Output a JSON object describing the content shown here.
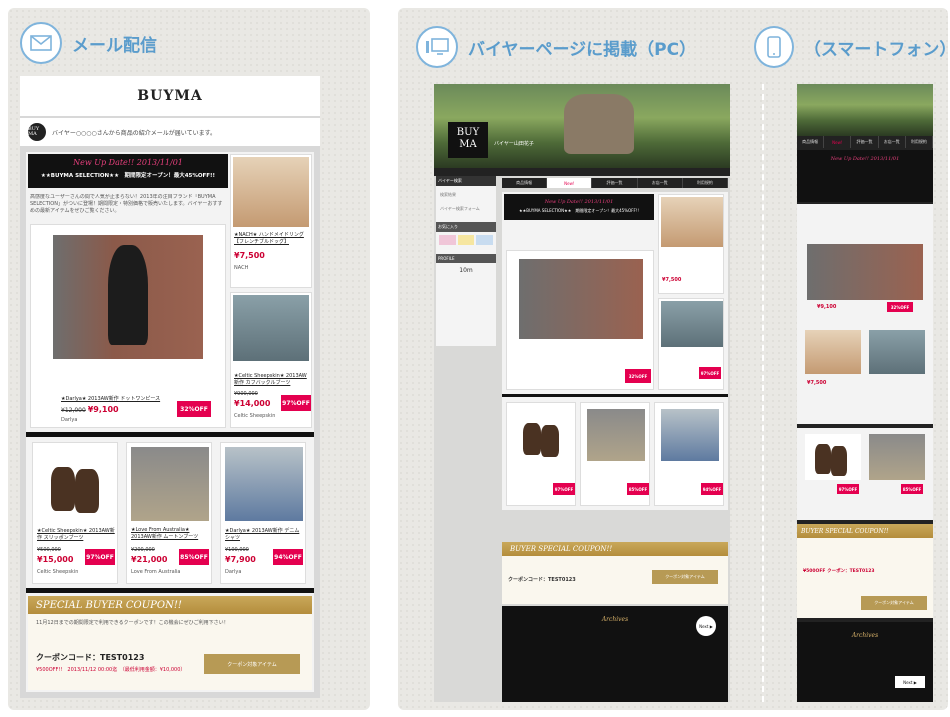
{
  "sections": {
    "mail": {
      "title": "メール配信",
      "icon": "envelope-icon"
    },
    "pc": {
      "title": "バイヤーページに掲載（PC）",
      "icon": "monitor-icon"
    },
    "sp": {
      "title": "（スマートフォン）",
      "icon": "smartphone-icon"
    }
  },
  "email": {
    "brand": "BUYMA",
    "logo_text": "BUY MA",
    "sender_line": "バイヤー○○○○さんから商品の紹介メールが届いています。",
    "banner": {
      "script": "New Up Date!! 2013/11/01",
      "headline": "★★BUYMA SELECTION★★　期間限定オープン！最大45%OFF!!"
    },
    "intro": "高感度なユーザーさんの間で人気が止まらない！2013年の注目ブランド「BUYMA SELECTION」がついに登場！期間限定・特別価格で販売いたします。バイヤーおすすめの最新アイテムをぜひご覧ください。",
    "products": [
      {
        "name": "★Darlya★ 2013AW新作 ドットワンピース",
        "orig": "¥12,000",
        "price": "¥9,100",
        "off": "32%OFF",
        "shop": "Darlya"
      },
      {
        "name": "★NACH★ ハンドメイドリング【フレンチブルドッグ】",
        "price": "¥7,500",
        "shop": "NACH"
      },
      {
        "name": "★Celtic Sheepskin★ 2013AW新作 カフバックルブーツ",
        "orig": "¥900,000",
        "price": "¥14,000",
        "off": "97%OFF",
        "shop": "Celtic Sheepskin"
      },
      {
        "name": "★Celtic Sheepskin★ 2013AW新作 スリッポンブーツ",
        "orig": "¥500,000",
        "price": "¥15,000",
        "off": "97%OFF",
        "shop": "Celtic Sheepskin"
      },
      {
        "name": "★Love From Australia★ 2013AW新作 ムートンブーツ",
        "orig": "¥200,000",
        "price": "¥21,000",
        "off": "85%OFF",
        "shop": "Love From Australia"
      },
      {
        "name": "★Darlya★ 2013AW新作 デニムシャツ",
        "orig": "¥100,000",
        "price": "¥7,900",
        "off": "94%OFF",
        "shop": "Darlya"
      }
    ],
    "coupon": {
      "heading": "SPECIAL BUYER COUPON!!",
      "note": "11月12日までの期間限定で利用できるクーポンです！この機会にぜひご利用下さい！",
      "code_label": "クーポンコード：TEST0123",
      "detail": "¥500OFF!!　2013/11/12 00:00迄　（最低利用金額：¥10,000）",
      "button": "クーポン対象アイテム"
    }
  },
  "pc": {
    "logo": "BUY MA",
    "buyer_name": "バイヤー山田花子",
    "tabs": [
      "商品情報",
      "New!",
      "評価一覧",
      "お店一覧",
      "利用規約"
    ],
    "side": [
      "バイヤー検索",
      "検索結果",
      "バイヤー検索フォーム",
      "お気に入り",
      "PROFILE"
    ],
    "follow": "10m",
    "coupon_heading": "BUYER SPECIAL COUPON!!",
    "coupon_code": "クーポンコード：TEST0123",
    "archive": "Archives",
    "next": "Next ▶"
  },
  "sp": {
    "coupon_heading": "BUYER SPECIAL COUPON!!",
    "coupon_code": "¥500OFF クーポン：TEST0123",
    "archive": "Archives",
    "next": "Next ▶"
  }
}
